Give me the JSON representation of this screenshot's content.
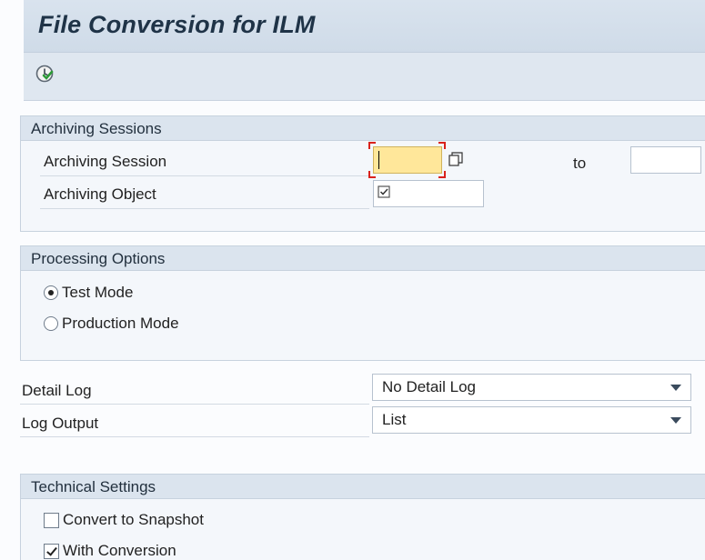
{
  "title": "File Conversion for ILM",
  "toolbar": {
    "execute_icon": "execute-clock-icon"
  },
  "archiving_sessions": {
    "header": "Archiving Sessions",
    "session_label": "Archiving Session",
    "session_value": "",
    "to_label": "to",
    "to_value": "",
    "object_label": "Archiving Object",
    "object_value": ""
  },
  "processing_options": {
    "header": "Processing Options",
    "test_mode_label": "Test Mode",
    "test_mode_selected": true,
    "production_mode_label": "Production Mode",
    "production_mode_selected": false
  },
  "detail_log": {
    "label": "Detail Log",
    "value": "No Detail Log"
  },
  "log_output": {
    "label": "Log Output",
    "value": "List"
  },
  "technical_settings": {
    "header": "Technical Settings",
    "convert_snapshot_label": "Convert to Snapshot",
    "convert_snapshot_checked": false,
    "with_conversion_label": "With Conversion",
    "with_conversion_checked": true
  },
  "colors": {
    "title_bar": "#d9e3ee",
    "group_header": "#dbe4ee",
    "required_field": "#ffe79a",
    "focus_marker": "#d9221c"
  }
}
